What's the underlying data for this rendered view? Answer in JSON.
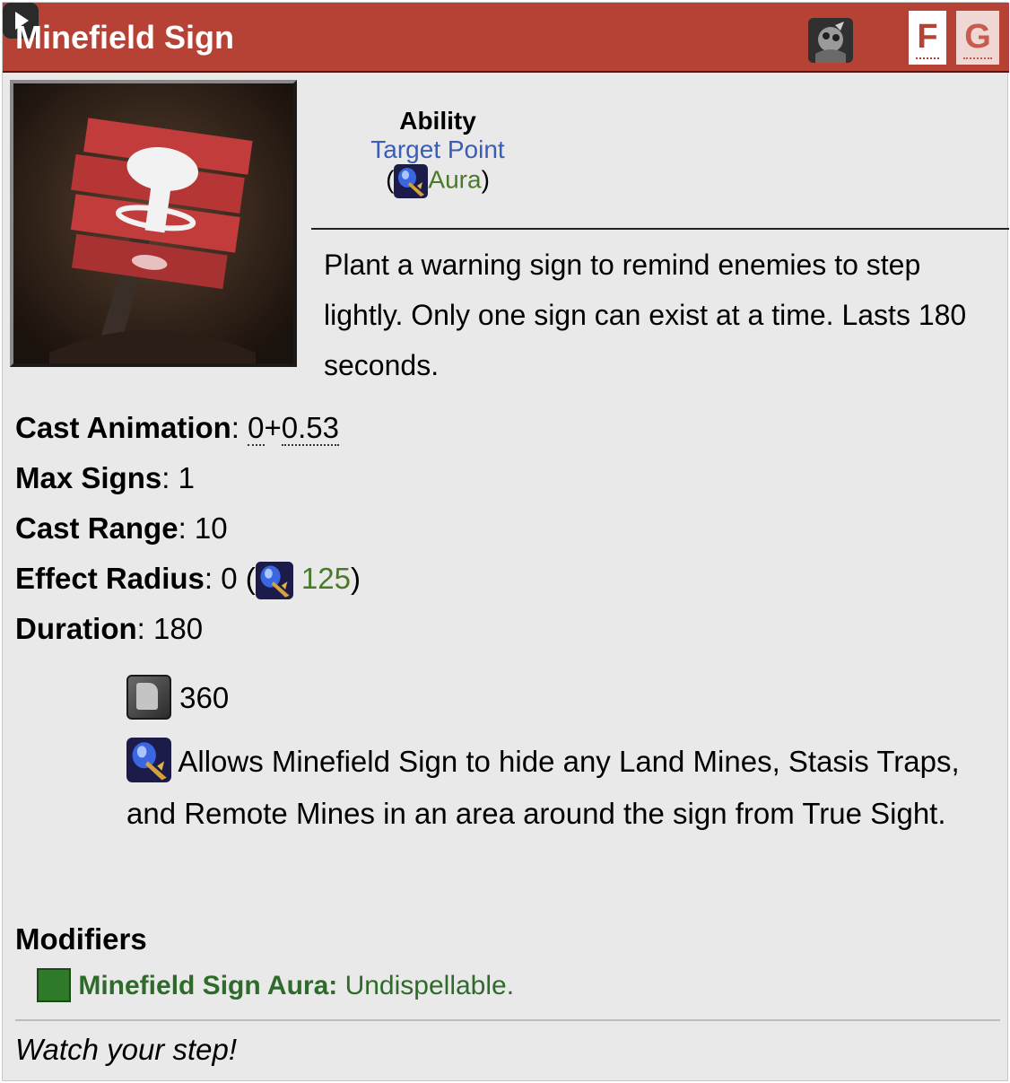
{
  "header": {
    "title": "Minefield Sign",
    "hero_icon": "techies-hero-icon",
    "play_icon": "play-icon",
    "button_f": "F",
    "button_g": "G",
    "color": "#b64235"
  },
  "ability": {
    "image_icon": "minefield-sign-icon",
    "type": "Ability",
    "behavior": "Target Point",
    "scepter_open": "(",
    "scepter_behavior": "Aura",
    "scepter_close": ")",
    "description": "Plant a warning sign to remind enemies to step lightly. Only one sign can exist at a time. Lasts 180 seconds."
  },
  "stats": {
    "cast_animation": {
      "label": "Cast Animation",
      "sep": ": ",
      "value_a": "0",
      "plus": "+",
      "value_b": "0.53"
    },
    "max_signs": {
      "label": "Max Signs",
      "sep": ": ",
      "value": "1"
    },
    "cast_range": {
      "label": "Cast Range",
      "sep": ": ",
      "value": "10"
    },
    "effect_radius": {
      "label": "Effect Radius",
      "sep": ": ",
      "value": "0",
      "open": " (",
      "scepter_value": "125",
      "close": ")"
    },
    "duration": {
      "label": "Duration",
      "sep": ": ",
      "value": "180"
    }
  },
  "cooldown": {
    "icon": "cooldown-icon",
    "value": "360"
  },
  "scepter_upgrade": {
    "icon": "aghanims-scepter-icon",
    "text": "Allows Minefield Sign to hide any Land Mines, Stasis Traps, and Remote Mines in an area around the sign from True Sight."
  },
  "modifiers": {
    "title": "Modifiers",
    "items": [
      {
        "name": "Minefield Sign Aura:",
        "desc": " Undispellable."
      }
    ]
  },
  "lore": "Watch your step!"
}
